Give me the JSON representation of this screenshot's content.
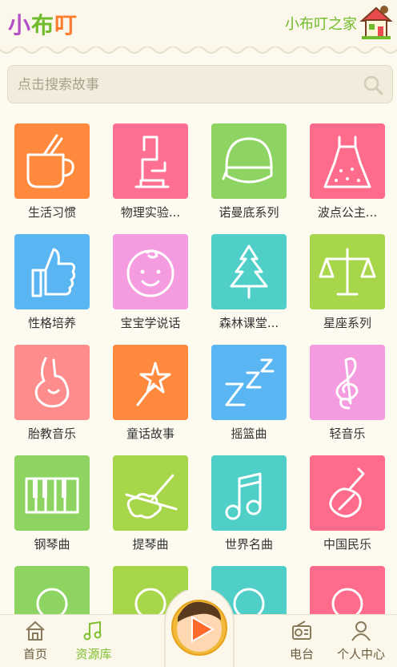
{
  "header": {
    "logo_chars": [
      "小",
      "布",
      "叮"
    ],
    "logo_colors": [
      "#b34fc4",
      "#6fbb2a",
      "#ff7b2e"
    ],
    "title": "小布叮之家"
  },
  "search": {
    "placeholder": "点击搜索故事"
  },
  "categories": [
    {
      "label": "生活习惯",
      "color": "#ff8a3d",
      "icon": "cup-icon"
    },
    {
      "label": "物理实验...",
      "color": "#ff6f91",
      "icon": "microscope-icon"
    },
    {
      "label": "诺曼底系列",
      "color": "#8ed462",
      "icon": "helmet-icon"
    },
    {
      "label": "波点公主...",
      "color": "#ff6b8b",
      "icon": "dress-icon"
    },
    {
      "label": "性格培养",
      "color": "#5ab6f2",
      "icon": "thumbs-up-icon"
    },
    {
      "label": "宝宝学说话",
      "color": "#f59be0",
      "icon": "baby-face-icon"
    },
    {
      "label": "森林课堂...",
      "color": "#4fcfc8",
      "icon": "tree-icon"
    },
    {
      "label": "星座系列",
      "color": "#a7d64a",
      "icon": "scales-icon"
    },
    {
      "label": "胎教音乐",
      "color": "#ff8c8c",
      "icon": "pregnant-icon"
    },
    {
      "label": "童话故事",
      "color": "#ff8a3d",
      "icon": "magic-wand-icon"
    },
    {
      "label": "摇篮曲",
      "color": "#5ab6f2",
      "icon": "sleep-zzz-icon"
    },
    {
      "label": "轻音乐",
      "color": "#f59be0",
      "icon": "treble-clef-icon"
    },
    {
      "label": "钢琴曲",
      "color": "#8ed462",
      "icon": "piano-icon"
    },
    {
      "label": "提琴曲",
      "color": "#a7d64a",
      "icon": "violin-icon"
    },
    {
      "label": "世界名曲",
      "color": "#4fcfc8",
      "icon": "music-note-icon"
    },
    {
      "label": "中国民乐",
      "color": "#ff6b8b",
      "icon": "pipa-icon"
    },
    {
      "label": "",
      "color": "#8ed462",
      "icon": "partial-icon"
    },
    {
      "label": "",
      "color": "#a7d64a",
      "icon": "partial-icon"
    },
    {
      "label": "",
      "color": "#4fcfc8",
      "icon": "partial-icon"
    },
    {
      "label": "",
      "color": "#ff6b8b",
      "icon": "partial-icon"
    }
  ],
  "nav": {
    "home": "首页",
    "library": "资源库",
    "radio": "电台",
    "profile": "个人中心",
    "active": "library"
  }
}
